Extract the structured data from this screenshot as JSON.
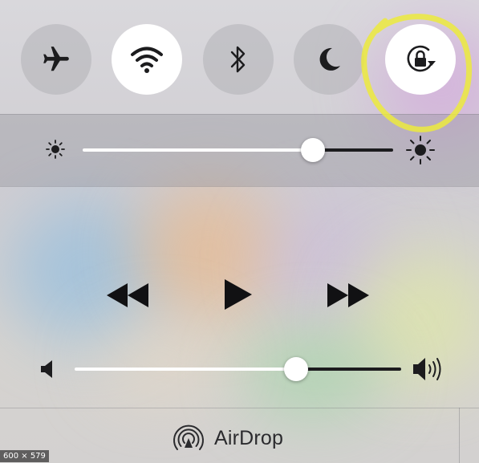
{
  "control_center": {
    "toggles": [
      {
        "name": "airplane-mode",
        "icon": "airplane-icon",
        "on": false
      },
      {
        "name": "wifi",
        "icon": "wifi-icon",
        "on": true
      },
      {
        "name": "bluetooth",
        "icon": "bluetooth-icon",
        "on": false
      },
      {
        "name": "do-not-disturb",
        "icon": "moon-icon",
        "on": false
      },
      {
        "name": "rotation-lock",
        "icon": "rotation-lock-icon",
        "on": true
      }
    ],
    "highlight_color": "#f2ee4a",
    "brightness": {
      "value": 0.83
    },
    "playback": {
      "buttons": [
        "rewind-icon",
        "play-icon",
        "fast-forward-icon"
      ]
    },
    "volume": {
      "value": 0.68
    },
    "airdrop": {
      "label": "AirDrop",
      "icon": "airdrop-icon"
    }
  },
  "image_badge": {
    "text": "600 × 579"
  }
}
